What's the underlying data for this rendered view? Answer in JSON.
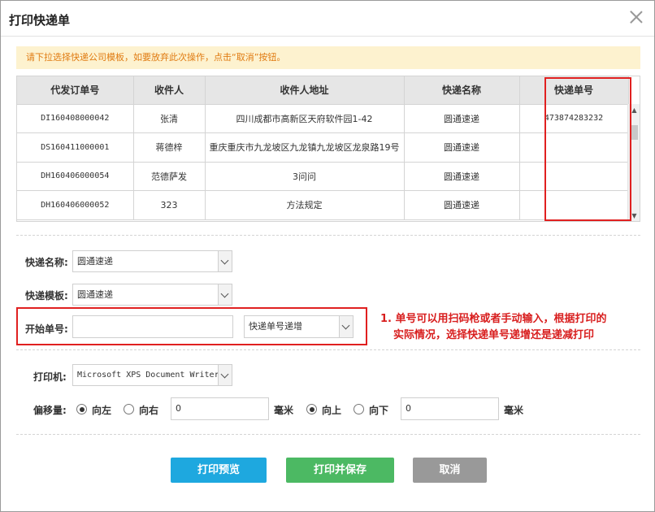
{
  "dialog": {
    "title": "打印快递单"
  },
  "notice": "请下拉选择快递公司模板，如要放弃此次操作，点击“取消”按钮。",
  "table": {
    "headers": [
      "代发订单号",
      "收件人",
      "收件人地址",
      "快递名称",
      "快递单号"
    ],
    "rows": [
      [
        "DI160408000042",
        "张清",
        "四川成都市高新区天府软件园1-42",
        "圆通速递",
        "473874283232"
      ],
      [
        "DS160411000001",
        "蒋德梓",
        "重庆重庆市九龙坡区九龙镇九龙坡区龙泉路19号",
        "圆通速递",
        ""
      ],
      [
        "DH160406000054",
        "范德萨发",
        "3问问",
        "圆通速递",
        ""
      ],
      [
        "DH160406000052",
        "323",
        "方法规定",
        "圆通速递",
        ""
      ]
    ]
  },
  "form": {
    "express_name_label": "快递名称:",
    "express_name_value": "圆通速递",
    "express_template_label": "快递模板:",
    "express_template_value": "圆通速递",
    "start_no_label": "开始单号:",
    "start_no_value": "",
    "increment_value": "快递单号递增",
    "printer_label": "打印机:",
    "printer_value": "Microsoft XPS Document Writer",
    "offset_label": "偏移量:",
    "left_label": "向左",
    "right_label": "向右",
    "h_offset_value": "0",
    "unit_mm": "毫米",
    "up_label": "向上",
    "down_label": "向下",
    "v_offset_value": "0",
    "unit_mm2": "毫米"
  },
  "annotation": {
    "line1": "1. 单号可以用扫码枪或者手动输入，根据打印的",
    "line2": "实际情况，选择快递单号递增还是递减打印"
  },
  "buttons": {
    "preview": "打印预览",
    "print_save": "打印并保存",
    "cancel": "取消"
  },
  "colors": {
    "preview": "#1ea8df",
    "print_save": "#4cb963",
    "cancel": "#999999",
    "highlight": "#e02020",
    "notice_bg": "#fdf2cf",
    "notice_text": "#e07b12"
  }
}
